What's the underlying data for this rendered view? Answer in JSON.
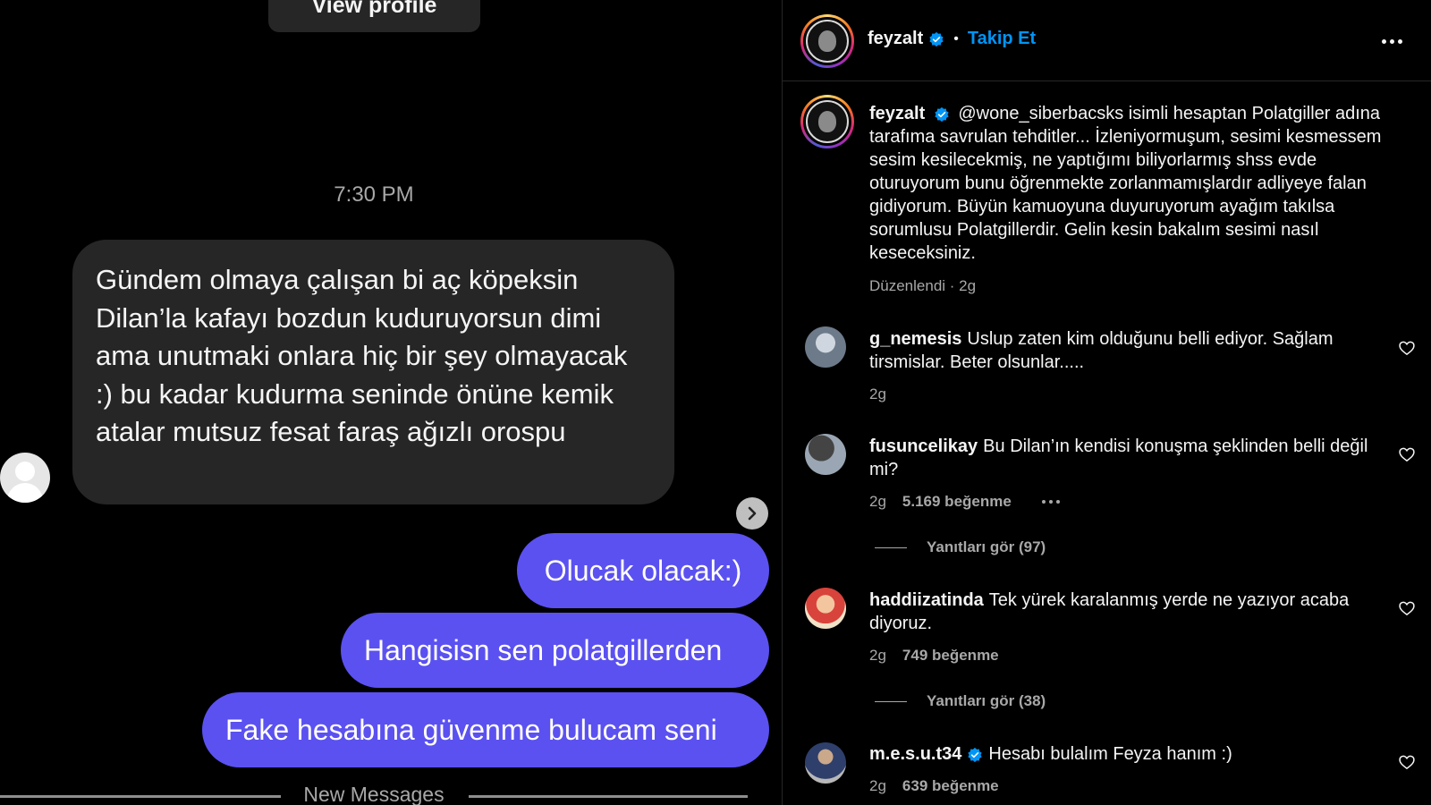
{
  "dm": {
    "view_profile_label": "View profile",
    "timestamp": "7:30 PM",
    "incoming_message": "Gündem olmaya çalışan bi aç köpeksin Dilan’la kafayı bozdun kuduruyorsun dimi ama unutmaki onlara hiç bir şey olmayacak :) bu kadar kudurma seninde önüne kemik atalar mutsuz fesat faraş ağızlı orospu",
    "outgoing_messages": [
      "Olucak olacak:)",
      "Hangisisn sen polatgillerden",
      "Fake hesabına güvenme bulucam seni"
    ],
    "new_messages_label": "New Messages"
  },
  "post": {
    "header": {
      "username": "feyzalt",
      "follow_label": "Takip Et",
      "separator": "•"
    },
    "caption": {
      "username": "feyzalt",
      "text": "@wone_siberbacsks isimli hesaptan Polatgiller adına tarafıma savrulan tehditler... İzleniyormuşum, sesimi kesmessem sesim kesilecekmiş, ne yaptığımı biliyorlarmış shss evde oturuyorum bunu öğrenmekte zorlanmamışlardır adliyeye falan gidiyorum. Büyün kamuoyuna duyuruyorum ayağım takılsa sorumlusu Polatgillerdir. Gelin kesin bakalım sesimi nasıl keseceksiniz.",
      "meta": "Düzenlendi · 2g"
    },
    "comments": [
      {
        "username": "g_nemesis",
        "text": "Uslup zaten kim olduğunu belli ediyor. Sağlam tirsmislar. Beter olsunlar.....",
        "time": "2g",
        "likes": "",
        "verified": false
      },
      {
        "username": "fusuncelikay",
        "text": "Bu Dilan’ın kendisi konuşma şeklinden belli değil mi?",
        "time": "2g",
        "likes": "5.169 beğenme",
        "replies": "Yanıtları gör (97)",
        "verified": false
      },
      {
        "username": "haddiizatinda",
        "text": "Tek yürek karalanmış yerde ne yazıyor acaba diyoruz.",
        "time": "2g",
        "likes": "749 beğenme",
        "replies": "Yanıtları gör (38)",
        "verified": false
      },
      {
        "username": "m.e.s.u.t34",
        "text": "Hesabı bulalım Feyza hanım :)",
        "time": "2g",
        "likes": "639 beğenme",
        "verified": true
      }
    ]
  },
  "colors": {
    "outgoing_bubble": "#5b51f0",
    "incoming_bubble": "#262626",
    "link_blue": "#0095f6",
    "verified_blue": "#0095f6"
  },
  "icons": [
    "default-avatar-icon",
    "chevron-right-icon",
    "verified-badge-icon",
    "more-options-icon",
    "heart-icon"
  ]
}
